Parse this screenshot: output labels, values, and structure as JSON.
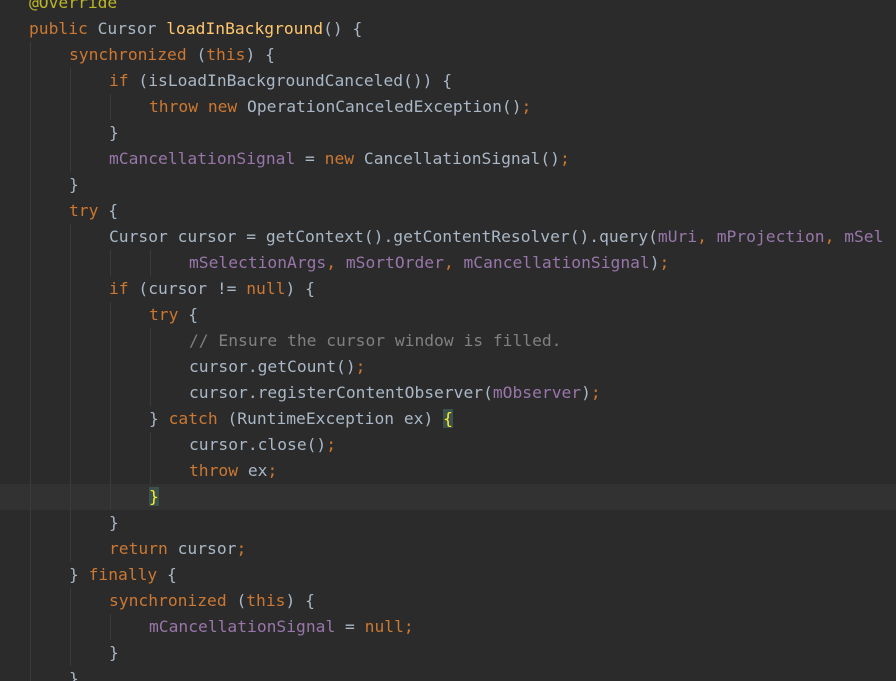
{
  "editor": {
    "lines": [
      {
        "indent": 0,
        "tokens": [
          {
            "t": "@Override",
            "c": "ann"
          }
        ]
      },
      {
        "indent": 0,
        "tokens": [
          {
            "t": "public ",
            "c": "kw"
          },
          {
            "t": "Cursor ",
            "c": "plain"
          },
          {
            "t": "loadInBackground",
            "c": "fn"
          },
          {
            "t": "() {",
            "c": "plain"
          }
        ]
      },
      {
        "indent": 1,
        "tokens": [
          {
            "t": "synchronized ",
            "c": "kw"
          },
          {
            "t": "(",
            "c": "plain"
          },
          {
            "t": "this",
            "c": "kw"
          },
          {
            "t": ") {",
            "c": "plain"
          }
        ]
      },
      {
        "indent": 2,
        "tokens": [
          {
            "t": "if ",
            "c": "kw"
          },
          {
            "t": "(isLoadInBackgroundCanceled()) {",
            "c": "plain"
          }
        ]
      },
      {
        "indent": 3,
        "tokens": [
          {
            "t": "throw new ",
            "c": "kw"
          },
          {
            "t": "OperationCanceledException()",
            "c": "plain"
          },
          {
            "t": ";",
            "c": "kw"
          }
        ]
      },
      {
        "indent": 2,
        "tokens": [
          {
            "t": "}",
            "c": "plain"
          }
        ]
      },
      {
        "indent": 2,
        "tokens": [
          {
            "t": "mCancellationSignal",
            "c": "field"
          },
          {
            "t": " = ",
            "c": "plain"
          },
          {
            "t": "new ",
            "c": "kw"
          },
          {
            "t": "CancellationSignal()",
            "c": "plain"
          },
          {
            "t": ";",
            "c": "kw"
          }
        ]
      },
      {
        "indent": 1,
        "tokens": [
          {
            "t": "}",
            "c": "plain"
          }
        ]
      },
      {
        "indent": 1,
        "tokens": [
          {
            "t": "try ",
            "c": "kw"
          },
          {
            "t": "{",
            "c": "plain"
          }
        ]
      },
      {
        "indent": 2,
        "tokens": [
          {
            "t": "Cursor cursor = getContext().getContentResolver().query(",
            "c": "plain"
          },
          {
            "t": "mUri",
            "c": "field"
          },
          {
            "t": ", ",
            "c": "kw"
          },
          {
            "t": "mProjection",
            "c": "field"
          },
          {
            "t": ", ",
            "c": "kw"
          },
          {
            "t": "mSel",
            "c": "field"
          }
        ]
      },
      {
        "indent": 4,
        "tokens": [
          {
            "t": "mSelectionArgs",
            "c": "field"
          },
          {
            "t": ", ",
            "c": "kw"
          },
          {
            "t": "mSortOrder",
            "c": "field"
          },
          {
            "t": ", ",
            "c": "kw"
          },
          {
            "t": "mCancellationSignal",
            "c": "field"
          },
          {
            "t": ")",
            "c": "plain"
          },
          {
            "t": ";",
            "c": "kw"
          }
        ]
      },
      {
        "indent": 2,
        "tokens": [
          {
            "t": "if ",
            "c": "kw"
          },
          {
            "t": "(cursor != ",
            "c": "plain"
          },
          {
            "t": "null",
            "c": "kw"
          },
          {
            "t": ") {",
            "c": "plain"
          }
        ]
      },
      {
        "indent": 3,
        "tokens": [
          {
            "t": "try ",
            "c": "kw"
          },
          {
            "t": "{",
            "c": "plain"
          }
        ]
      },
      {
        "indent": 4,
        "tokens": [
          {
            "t": "// Ensure the cursor window is filled.",
            "c": "comment"
          }
        ]
      },
      {
        "indent": 4,
        "tokens": [
          {
            "t": "cursor.getCount()",
            "c": "plain"
          },
          {
            "t": ";",
            "c": "kw"
          }
        ]
      },
      {
        "indent": 4,
        "tokens": [
          {
            "t": "cursor.registerContentObserver(",
            "c": "plain"
          },
          {
            "t": "mObserver",
            "c": "field"
          },
          {
            "t": ")",
            "c": "plain"
          },
          {
            "t": ";",
            "c": "kw"
          }
        ]
      },
      {
        "indent": 3,
        "tokens": [
          {
            "t": "} ",
            "c": "plain"
          },
          {
            "t": "catch ",
            "c": "kw"
          },
          {
            "t": "(RuntimeException ex) ",
            "c": "plain"
          },
          {
            "t": "{",
            "c": "brace-match"
          }
        ]
      },
      {
        "indent": 4,
        "tokens": [
          {
            "t": "cursor.close()",
            "c": "plain"
          },
          {
            "t": ";",
            "c": "kw"
          }
        ]
      },
      {
        "indent": 4,
        "tokens": [
          {
            "t": "throw ",
            "c": "kw"
          },
          {
            "t": "ex",
            "c": "plain"
          },
          {
            "t": ";",
            "c": "kw"
          }
        ]
      },
      {
        "indent": 3,
        "current": true,
        "tokens": [
          {
            "t": "}",
            "c": "brace-match"
          }
        ]
      },
      {
        "indent": 2,
        "tokens": [
          {
            "t": "}",
            "c": "plain"
          }
        ]
      },
      {
        "indent": 2,
        "tokens": [
          {
            "t": "return ",
            "c": "kw"
          },
          {
            "t": "cursor",
            "c": "plain"
          },
          {
            "t": ";",
            "c": "kw"
          }
        ]
      },
      {
        "indent": 1,
        "tokens": [
          {
            "t": "} ",
            "c": "plain"
          },
          {
            "t": "finally ",
            "c": "kw"
          },
          {
            "t": "{",
            "c": "plain"
          }
        ]
      },
      {
        "indent": 2,
        "tokens": [
          {
            "t": "synchronized ",
            "c": "kw"
          },
          {
            "t": "(",
            "c": "plain"
          },
          {
            "t": "this",
            "c": "kw"
          },
          {
            "t": ") {",
            "c": "plain"
          }
        ]
      },
      {
        "indent": 3,
        "tokens": [
          {
            "t": "mCancellationSignal",
            "c": "field"
          },
          {
            "t": " = ",
            "c": "plain"
          },
          {
            "t": "null",
            "c": "kw"
          },
          {
            "t": ";",
            "c": "kw"
          }
        ]
      },
      {
        "indent": 2,
        "tokens": [
          {
            "t": "}",
            "c": "plain"
          }
        ]
      },
      {
        "indent": 1,
        "tokens": [
          {
            "t": "}",
            "c": "plain"
          }
        ]
      }
    ]
  }
}
